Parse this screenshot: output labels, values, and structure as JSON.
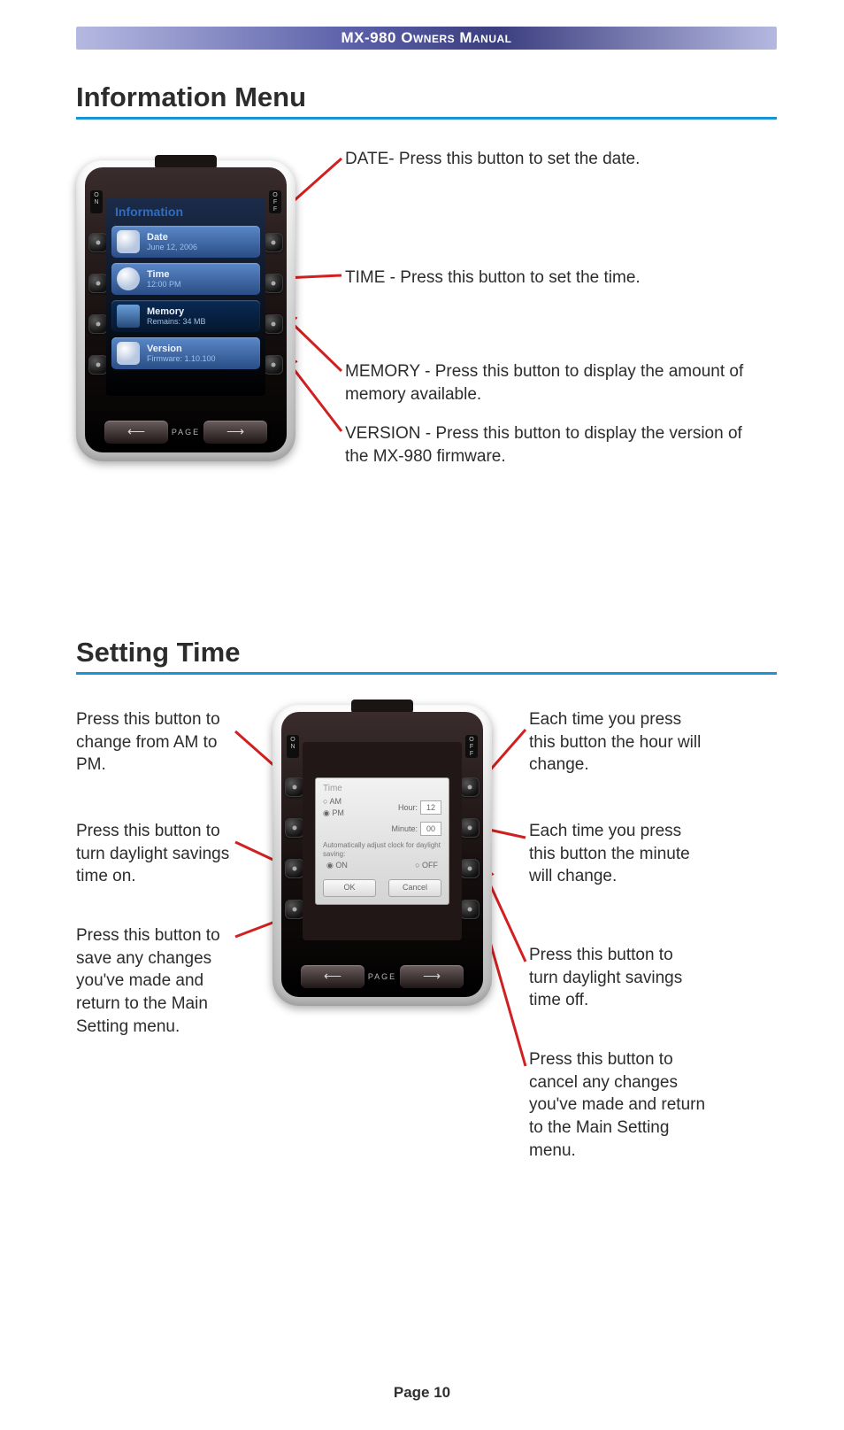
{
  "header": {
    "title": "MX-980 Owners Manual"
  },
  "section1": {
    "heading": "Information Menu",
    "callouts": {
      "date": "DATE- Press this button to set the date.",
      "time": "TIME - Press this button to set the time.",
      "memory": "MEMORY - Press this button to display the amount of memory available.",
      "version": "VERSION - Press this button to display the version of the MX-980 firmware."
    },
    "screen": {
      "title": "Information",
      "rows": [
        {
          "label": "Date",
          "value": "June 12, 2006"
        },
        {
          "label": "Time",
          "value": "12:00 PM"
        },
        {
          "label": "Memory",
          "value": "Remains: 34 MB"
        },
        {
          "label": "Version",
          "value": "Firmware: 1.10.100"
        }
      ]
    },
    "page_label": "PAGE",
    "on_label": "ON",
    "off_label": "OFF"
  },
  "section2": {
    "heading": "Setting Time",
    "callouts_left": {
      "ampm": "Press this button to change from AM to PM.",
      "dst_on": "Press this button to turn daylight savings time on.",
      "save": "Press this button to save any changes you've made and return to the Main Setting menu."
    },
    "callouts_right": {
      "hour": "Each time you press this button the hour will change.",
      "minute": "Each time you press this button the minute will change.",
      "dst_off": "Press this button to turn daylight savings time off.",
      "cancel": "Press this button to cancel any changes you've made and return to the Main Setting menu."
    },
    "dialog": {
      "title": "Time",
      "am": "AM",
      "pm": "PM",
      "hour_label": "Hour:",
      "hour_value": "12",
      "minute_label": "Minute:",
      "minute_value": "00",
      "dst_caption": "Automatically adjust clock for daylight saving:",
      "on": "ON",
      "off": "OFF",
      "ok": "OK",
      "cancel": "Cancel"
    },
    "page_label": "PAGE"
  },
  "footer": {
    "page": "Page 10"
  }
}
